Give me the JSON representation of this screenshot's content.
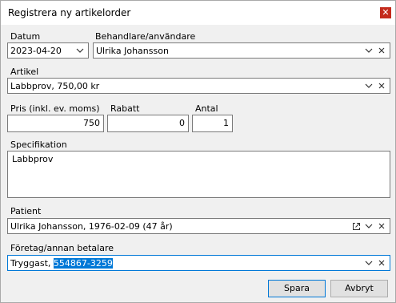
{
  "window": {
    "title": "Registrera ny artikelorder",
    "close_glyph": "✕"
  },
  "labels": {
    "datum": "Datum",
    "behandlare": "Behandlare/användare",
    "artikel": "Artikel",
    "pris": "Pris (inkl. ev. moms)",
    "rabatt": "Rabatt",
    "antal": "Antal",
    "specifikation": "Specifikation",
    "patient": "Patient",
    "betalare": "Företag/annan betalare"
  },
  "fields": {
    "datum": "2023-04-20",
    "behandlare": "Ulrika Johansson",
    "artikel": "Labbprov, 750,00 kr",
    "pris": "750",
    "rabatt": "0",
    "antal": "1",
    "specifikation": "Labbprov",
    "patient": "Ulrika Johansson, 1976-02-09 (47 år)",
    "betalare_prefix": "Tryggast, ",
    "betalare_selected": "554867-3259"
  },
  "buttons": {
    "save": "Spara",
    "cancel": "Avbryt"
  },
  "icons": {
    "dropdown": "chevron-down-icon",
    "clear": "close-icon",
    "open": "external-link-icon"
  },
  "colors": {
    "accent": "#0078d7",
    "close_button": "#c42b1c"
  }
}
